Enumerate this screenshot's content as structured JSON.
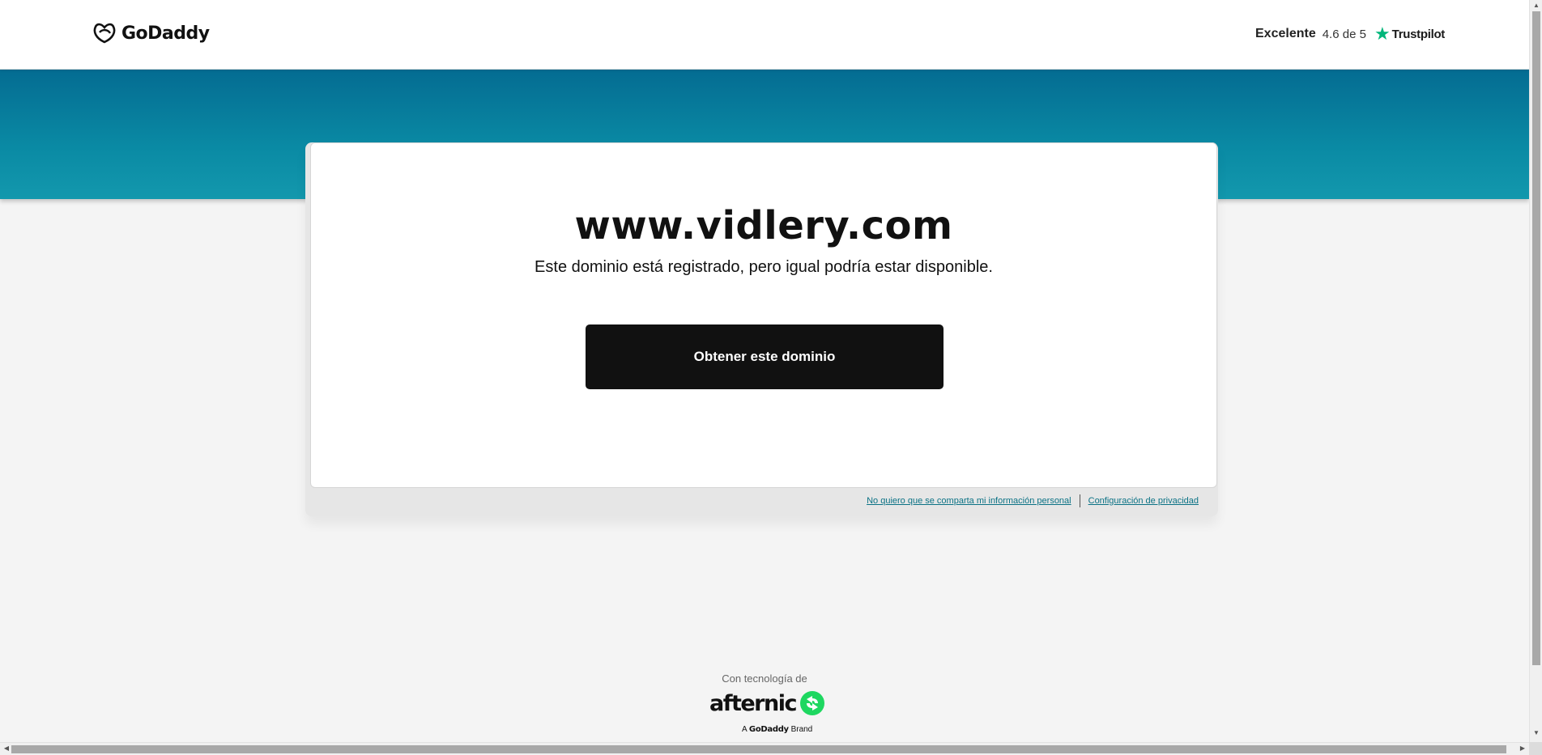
{
  "header": {
    "logo_text": "GoDaddy",
    "trustpilot": {
      "rating_word": "Excelente",
      "score": "4.6 de 5",
      "brand": "Trustpilot"
    }
  },
  "main": {
    "domain": "www.vidlery.com",
    "subtitle": "Este dominio está registrado, pero igual podría estar disponible.",
    "cta_label": "Obtener este dominio"
  },
  "privacy": {
    "opt_out_link": "No quiero que se comparta mi información personal",
    "settings_link": "Configuración de privacidad"
  },
  "footer": {
    "powered_by": "Con tecnología de",
    "partner_logo": "afternic",
    "brand_prefix": "A",
    "brand_name": "GoDaddy",
    "brand_suffix": "Brand"
  },
  "colors": {
    "banner_top": "#046c92",
    "banner_bottom": "#1398ad",
    "cta_bg": "#111111",
    "link": "#0b7285",
    "trustpilot_green": "#00b67a",
    "afternic_green": "#1ed760"
  },
  "icons": [
    "godaddy-logo-icon",
    "trustpilot-star-icon",
    "afternic-logo-icon"
  ]
}
